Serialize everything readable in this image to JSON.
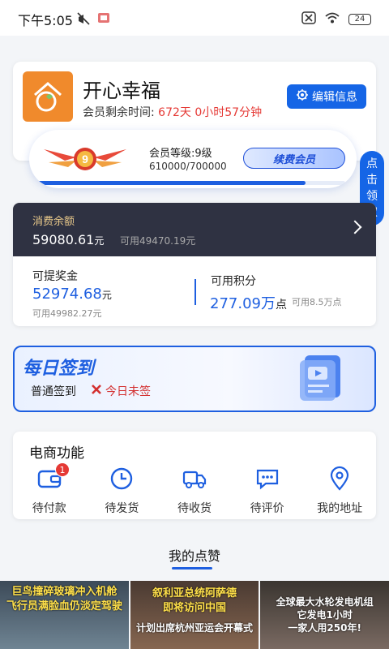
{
  "status_bar": {
    "time": "下午5:05",
    "battery": "24"
  },
  "profile": {
    "name": "开心幸福",
    "remain_label": "会员剩余时间:",
    "remain_value": "672天 0小时57分钟",
    "edit_label": "编辑信息"
  },
  "level": {
    "label": "会员等级:9级",
    "points": "610000/700000",
    "progress": 0.87,
    "badge_num": "9",
    "renew_label": "续费会员"
  },
  "side_claim": {
    "label": "点击领取"
  },
  "balance": {
    "title": "消费余额",
    "value": "59080.61",
    "unit": "元",
    "available": "可用49470.19元"
  },
  "withdraw": {
    "title": "可提奖金",
    "value": "52974.68",
    "unit": "元",
    "available": "可用49982.27元"
  },
  "points": {
    "title": "可用积分",
    "value": "277.09万",
    "unit": "点",
    "available": "可用8.5万点"
  },
  "signin": {
    "title": "每日签到",
    "type": "普通签到",
    "status": "今日未签"
  },
  "ecommerce": {
    "title": "电商功能",
    "items": [
      {
        "label": "待付款",
        "icon": "wallet-icon",
        "badge": "1"
      },
      {
        "label": "待发货",
        "icon": "clock-icon"
      },
      {
        "label": "待收货",
        "icon": "truck-icon"
      },
      {
        "label": "待评价",
        "icon": "chat-icon"
      },
      {
        "label": "我的地址",
        "icon": "location-icon"
      }
    ]
  },
  "likes": {
    "title": "我的点赞",
    "thumbs": [
      {
        "line1": "巨鸟撞碎玻璃冲入机舱",
        "line2": "飞行员满脸血仍淡定驾驶"
      },
      {
        "line1": "叙利亚总统阿萨德",
        "line2": "即将访问中国",
        "line3": "计划出席杭州亚运会开幕式"
      },
      {
        "line1": "全球最大水轮发电机组",
        "line2": "它发电1小时",
        "line3": "一家人用250年!"
      }
    ]
  },
  "colors": {
    "accent": "#1e5fe0",
    "dark_panel": "#2f3242",
    "gold": "#e8c88a",
    "red": "#e53935"
  }
}
